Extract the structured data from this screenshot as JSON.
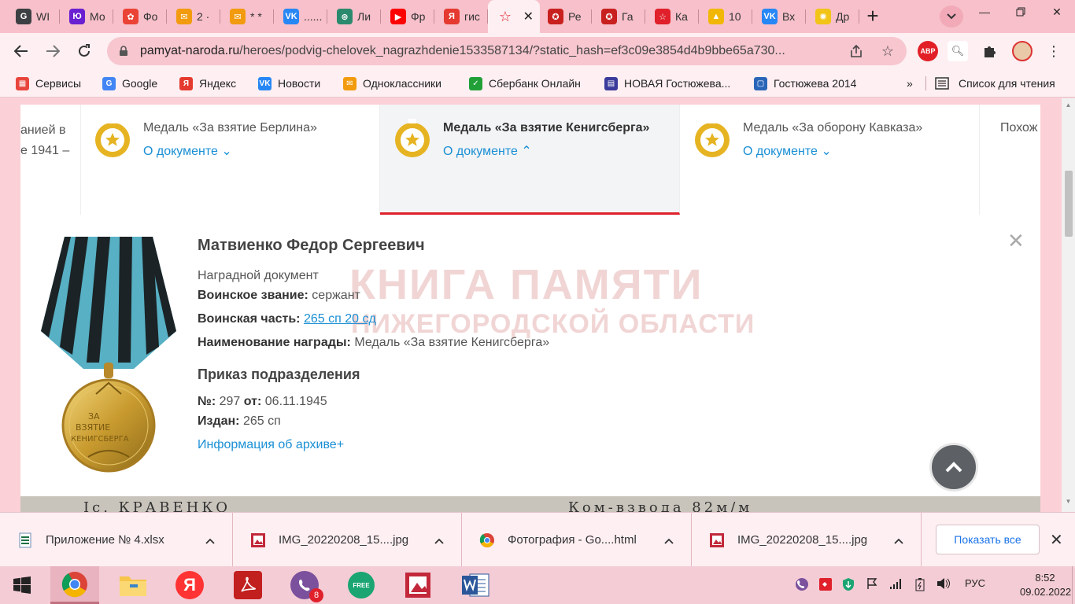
{
  "tabs": [
    {
      "label": "WI",
      "fav_color": "#3c4043",
      "fav_text": "G"
    },
    {
      "label": "Мо",
      "fav_color": "#6a1fd1",
      "fav_text": "Ю"
    },
    {
      "label": "Фо",
      "fav_color": "#ea4335",
      "fav_text": "✿"
    },
    {
      "label": "2 ·",
      "fav_color": "#f29b0e",
      "fav_text": "✉"
    },
    {
      "label": "* *",
      "fav_color": "#f29b0e",
      "fav_text": "✉"
    },
    {
      "label": "......",
      "fav_color": "#2787f5",
      "fav_text": "VK"
    },
    {
      "label": "Ли",
      "fav_color": "#2b8a6e",
      "fav_text": "⊛"
    },
    {
      "label": "Фр",
      "fav_color": "#ff0000",
      "fav_text": "▶"
    },
    {
      "label": "гис",
      "fav_color": "#e53a2f",
      "fav_text": "Я"
    },
    {
      "label": "",
      "fav_color": "#e0202a",
      "fav_text": "☆",
      "active": true
    },
    {
      "label": "Ре",
      "fav_color": "#c8201e",
      "fav_text": "✪"
    },
    {
      "label": "Га",
      "fav_color": "#c8201e",
      "fav_text": "✪"
    },
    {
      "label": "Ка",
      "fav_color": "#e0202a",
      "fav_text": "☆"
    },
    {
      "label": "10",
      "fav_color": "#f2b705",
      "fav_text": "▲"
    },
    {
      "label": "Вх",
      "fav_color": "#2787f5",
      "fav_text": "VK"
    },
    {
      "label": "Др",
      "fav_color": "#f2c418",
      "fav_text": "✺"
    }
  ],
  "address": {
    "url_domain": "pamyat-naroda.ru",
    "url_path": "/heroes/podvig-chelovek_nagrazhdenie1533587134/?static_hash=ef3c09e3854d4b9bbe65a730..."
  },
  "toolbar": {
    "abp_label": "ABP"
  },
  "bookmarks": [
    {
      "label": "Сервисы",
      "color": "#e8453c",
      "icon": "▦"
    },
    {
      "label": "Google",
      "color": "#4285f4",
      "icon": "G"
    },
    {
      "label": "Яндекс",
      "color": "#e53a2f",
      "icon": "Я"
    },
    {
      "label": "Новости",
      "color": "#2787f5",
      "icon": "VK"
    },
    {
      "label": "Одноклассники",
      "color": "#f29b0e",
      "icon": "✉"
    },
    {
      "label": "Сбербанк Онлайн",
      "color": "#21a038",
      "icon": "✓"
    },
    {
      "label": "НОВАЯ Гостюжева...",
      "color": "#3b3b9c",
      "icon": "▤"
    },
    {
      "label": "Гостюжева 2014",
      "color": "#2a66b8",
      "icon": "▢"
    }
  ],
  "bookmarks_more": "»",
  "reading_list": "Список для чтения",
  "medal_strip": {
    "partial_left_line1": "анией в",
    "partial_left_line2": "е 1941 –",
    "cards": [
      {
        "title": "Медаль «За взятие Берлина»",
        "doc": "О документе ⌄",
        "active": false
      },
      {
        "title": "Медаль «За взятие Кенигсберга»",
        "doc": "О документе ⌃",
        "active": true
      },
      {
        "title": "Медаль «За оборону Кавказа»",
        "doc": "О документе ⌄",
        "active": false
      }
    ],
    "partial_right": "Похож"
  },
  "detail": {
    "name": "Матвиенко Федор Сергеевич",
    "doc_type": "Наградной документ",
    "rank_label": "Воинское звание:",
    "rank_value": "сержант",
    "unit_label": "Воинская часть:",
    "unit_value": "265 сп 20 сд",
    "award_label": "Наименование награды:",
    "award_value": "Медаль «За взятие Кенигсберга»",
    "order_title": "Приказ подразделения",
    "order_no_label": "№:",
    "order_no": "297",
    "order_from_label": "от:",
    "order_date": "06.11.1945",
    "issued_label": "Издан:",
    "issued_value": "265 сп",
    "archive_link": "Информация об архиве+",
    "watermark_line1": "КНИГА ПАМЯТИ",
    "watermark_line2": "НИЖЕГОРОДСКОЙ ОБЛАСТИ",
    "medal_inscription_1": "ЗА",
    "medal_inscription_2": "ВЗЯТИЕ",
    "medal_inscription_3": "КЕНИГСБЕРГА"
  },
  "scan_strip": {
    "left_text": "Ic. КРАВЕНКО",
    "right_text": "Ком-взвода 82м/м"
  },
  "downloads": {
    "items": [
      {
        "name": "Приложение № 4.xlsx",
        "type": "xlsx"
      },
      {
        "name": "IMG_20220208_15....jpg",
        "type": "jpg"
      },
      {
        "name": "Фотография - Go....html",
        "type": "html"
      },
      {
        "name": "IMG_20220208_15....jpg",
        "type": "jpg"
      }
    ],
    "show_all": "Показать все"
  },
  "taskbar": {
    "viber_badge": "8",
    "free_label": "FREE",
    "lang": "РУС",
    "time": "8:52",
    "date": "09.02.2022"
  }
}
